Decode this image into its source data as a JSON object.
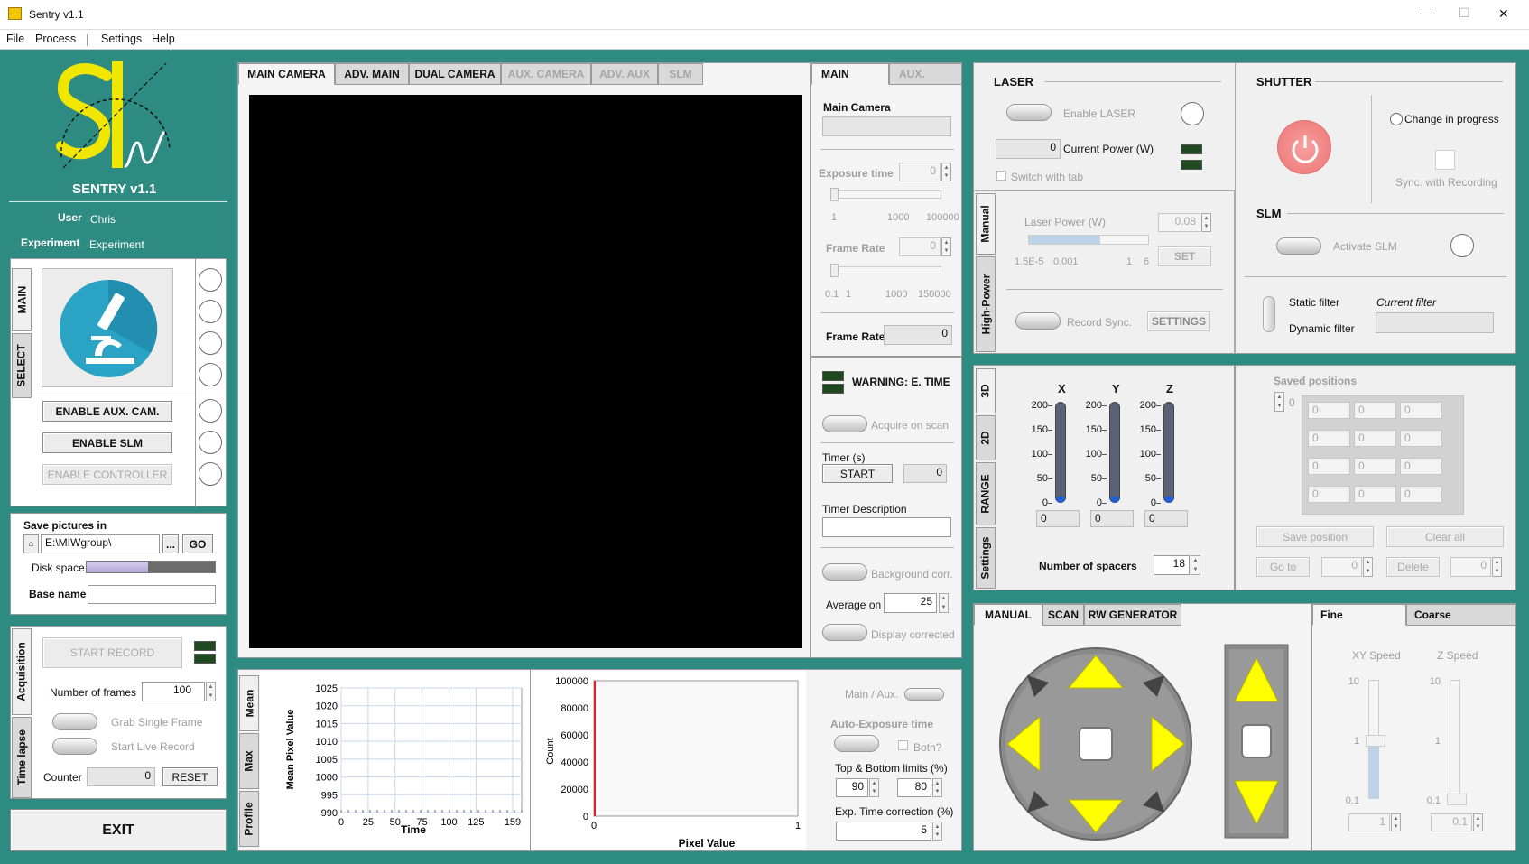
{
  "window": {
    "title": "Sentry v1.1",
    "minimize": "—",
    "maximize": "☐",
    "close": "✕"
  },
  "menu": [
    "File",
    "Process",
    "Settings",
    "Help"
  ],
  "sidebar": {
    "app_name": "SENTRY v1.1",
    "user_label": "User",
    "user_value": "Chris",
    "experiment_label": "Experiment",
    "experiment_value": "Experiment",
    "vtabs": [
      "MAIN",
      "SELECT"
    ],
    "enable_aux_cam": "ENABLE AUX. CAM.",
    "enable_slm": "ENABLE SLM",
    "enable_controller": "ENABLE CONTROLLER",
    "save_pictures_label": "Save pictures in",
    "save_path": "E:\\MIWgroup\\",
    "browse": "...",
    "go": "GO",
    "disk_space_label": "Disk space",
    "disk_space_used": 0.48,
    "base_name_label": "Base name",
    "base_name_value": "",
    "acq_tabs": [
      "Acquisition",
      "Time lapse"
    ],
    "start_record": "START RECORD",
    "frames_label": "Number of frames",
    "frames_value": "100",
    "grab_single": "Grab Single Frame",
    "start_live": "Start Live Record",
    "counter_label": "Counter",
    "counter_value": "0",
    "reset": "RESET",
    "exit": "EXIT"
  },
  "camera_tabs": [
    "MAIN CAMERA",
    "ADV. MAIN",
    "DUAL CAMERA",
    "AUX. CAMERA",
    "ADV. AUX",
    "SLM"
  ],
  "camera_settings": {
    "tabs": [
      "MAIN",
      "AUX."
    ],
    "main_camera_label": "Main Camera",
    "exposure_label": "Exposure time",
    "exposure_value": "0",
    "exposure_ticks": [
      "1",
      "1000",
      "100000"
    ],
    "framerate_label": "Frame Rate",
    "framerate_value": "0",
    "framerate_ticks": [
      "0.1",
      "1",
      "1000",
      "150000"
    ],
    "framerate_display_label": "Frame Rate",
    "framerate_display_value": "0",
    "warning": "WARNING: E. TIME",
    "acquire_on_scan": "Acquire on scan",
    "timer_label": "Timer (s)",
    "timer_start": "START",
    "timer_value": "0",
    "timer_desc_label": "Timer Description",
    "timer_desc_value": "",
    "background_corr": "Background corr.",
    "average_label": "Average on",
    "average_value": "25",
    "display_corrected": "Display corrected"
  },
  "plot_tabs": [
    "Mean",
    "Max",
    "Profile"
  ],
  "mean_plot": {
    "ylabel": "Mean Pixel Value",
    "xlabel": "Time",
    "yticks": [
      "1025",
      "1020",
      "1015",
      "1010",
      "1005",
      "1000",
      "995",
      "990"
    ],
    "xticks": [
      "0",
      "25",
      "50",
      "75",
      "100",
      "125",
      "159"
    ]
  },
  "hist_plot": {
    "ylabel": "Count",
    "xlabel": "Pixel Value",
    "yticks": [
      "100000",
      "80000",
      "60000",
      "40000",
      "20000",
      "0"
    ],
    "xticks": [
      "0",
      "1"
    ]
  },
  "auto_exposure": {
    "main_aux": "Main / Aux.",
    "title": "Auto-Exposure time",
    "both": "Both?",
    "limits_label": "Top & Bottom limits (%)",
    "top": "90",
    "bottom": "80",
    "correction_label": "Exp. Time correction (%)",
    "correction": "5"
  },
  "laser": {
    "title": "LASER",
    "enable": "Enable LASER",
    "power_value": "0",
    "power_label": "Current Power (W)",
    "switch_tab": "Switch with tab",
    "vtabs": [
      "Manual",
      "High-Power"
    ],
    "laser_power_label": "Laser Power (W)",
    "laser_power_value": "0.08",
    "ticks": [
      "1.5E-5",
      "0.001",
      "1",
      "6"
    ],
    "set": "SET",
    "record_sync": "Record Sync.",
    "settings": "SETTINGS"
  },
  "shutter": {
    "title": "SHUTTER",
    "change": "Change in progress",
    "sync": "Sync. with Recording"
  },
  "slm": {
    "title": "SLM",
    "activate": "Activate SLM",
    "static": "Static filter",
    "dynamic": "Dynamic filter",
    "current_filter": "Current filter"
  },
  "stage": {
    "vtabs": [
      "3D",
      "2D",
      "RANGE",
      "Settings"
    ],
    "axes": [
      "X",
      "Y",
      "Z"
    ],
    "ticks": [
      "200",
      "150",
      "100",
      "50",
      "0"
    ],
    "values": [
      "0",
      "0",
      "0"
    ],
    "spacers_label": "Number of spacers",
    "spacers_value": "18"
  },
  "positions": {
    "title": "Saved positions",
    "index": "0",
    "cells": [
      [
        "0",
        "0",
        "0"
      ],
      [
        "0",
        "0",
        "0"
      ],
      [
        "0",
        "0",
        "0"
      ],
      [
        "0",
        "0",
        "0"
      ]
    ],
    "save": "Save position",
    "clear": "Clear all",
    "goto": "Go to",
    "goto_value": "0",
    "delete": "Delete",
    "delete_value": "0"
  },
  "motion": {
    "tabs": [
      "MANUAL",
      "SCAN",
      "RW GENERATOR"
    ],
    "speed_tabs": [
      "Fine",
      "Coarse"
    ],
    "xy_speed": "XY Speed",
    "z_speed": "Z Speed",
    "speed_ticks": [
      "10",
      "1",
      "0.1"
    ],
    "xy_value": "1",
    "z_value": "0.1"
  }
}
